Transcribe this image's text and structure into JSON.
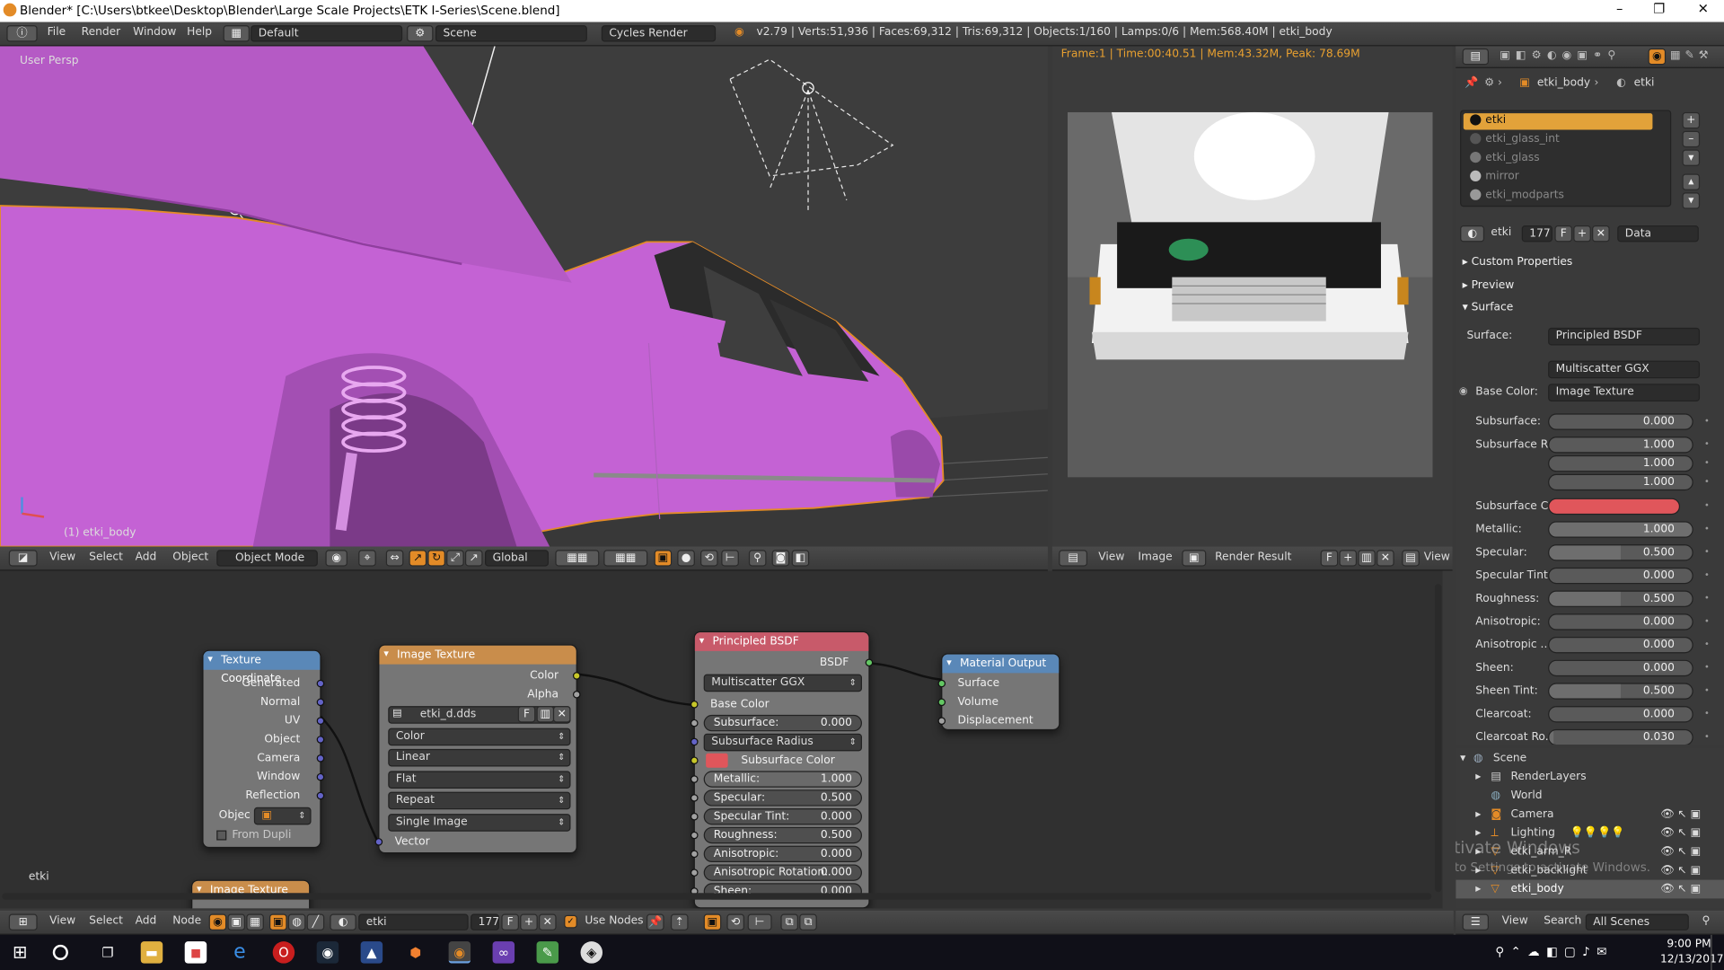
{
  "window": {
    "title": "Blender* [C:\\Users\\btkee\\Desktop\\Blender\\Large Scale Projects\\ETK I-Series\\Scene.blend]",
    "min": "–",
    "max": "❐",
    "close": "✕"
  },
  "info_header": {
    "menus": [
      "File",
      "Render",
      "Window",
      "Help"
    ],
    "screen_layout": "Default",
    "scene": "Scene",
    "engine": "Cycles Render",
    "stats": "v2.79 | Verts:51,936 | Faces:69,312 | Tris:69,312 | Objects:1/160 | Lamps:0/6 | Mem:568.40M | etki_body"
  },
  "viewport": {
    "view_name": "User Persp",
    "object_label": "(1) etki_body",
    "header": {
      "menus": [
        "View",
        "Select",
        "Add",
        "Object"
      ],
      "mode": "Object Mode",
      "orientation": "Global"
    }
  },
  "render_view": {
    "status": "Frame:1 | Time:00:40.51 | Mem:43.32M, Peak: 78.69M",
    "header": {
      "menus": [
        "View",
        "Image"
      ],
      "image_name": "Render Result",
      "f": "F",
      "view_label": "View"
    }
  },
  "nodes": {
    "texture_coordinate": {
      "title": "Texture Coordinate",
      "outputs": [
        "Generated",
        "Normal",
        "UV",
        "Object",
        "Camera",
        "Window",
        "Reflection"
      ],
      "object_label": "Objec",
      "from_dupli": "From Dupli"
    },
    "image_texture": {
      "title": "Image Texture",
      "outputs": [
        "Color",
        "Alpha"
      ],
      "image": "etki_d.dds",
      "f": "F",
      "color_space": "Color",
      "interpolation": "Linear",
      "projection": "Flat",
      "extension": "Repeat",
      "source": "Single Image",
      "input": "Vector"
    },
    "principled": {
      "title": "Principled BSDF",
      "output": "BSDF",
      "distribution": "Multiscatter GGX",
      "base_color": "Base Color",
      "subsurface_label": "Subsurface:",
      "subsurface": "0.000",
      "subsurface_radius": "Subsurface Radius",
      "subsurface_color": "Subsurface Color",
      "metallic_label": "Metallic:",
      "metallic": "1.000",
      "specular_label": "Specular:",
      "specular": "0.500",
      "spec_tint_label": "Specular Tint:",
      "spec_tint": "0.000",
      "roughness_label": "Roughness:",
      "roughness": "0.500",
      "aniso_label": "Anisotropic:",
      "aniso": "0.000",
      "aniso_rot_label": "Anisotropic Rotation:",
      "aniso_rot": "0.000",
      "sheen_label": "Sheen:",
      "sheen": "0.000"
    },
    "material_output": {
      "title": "Material Output",
      "inputs": [
        "Surface",
        "Volume",
        "Displacement"
      ]
    },
    "image_texture2": {
      "title": "Image Texture"
    },
    "material_name": "etki",
    "header": {
      "menus": [
        "View",
        "Select",
        "Add",
        "Node"
      ],
      "material": "etki",
      "users": "177",
      "f": "F",
      "use_nodes": "Use Nodes"
    }
  },
  "properties": {
    "breadcrumb": [
      "etki_body",
      "etki"
    ],
    "slots": [
      "etki",
      "etki_glass_int",
      "etki_glass",
      "mirror",
      "etki_modparts"
    ],
    "material_name": "etki",
    "users": "177",
    "f": "F",
    "link": "Data",
    "sections": [
      "Custom Properties",
      "Preview",
      "Surface"
    ],
    "surface_label": "Surface:",
    "surface": "Principled BSDF",
    "distribution": "Multiscatter GGX",
    "base_color_label": "Base Color:",
    "base_color": "Image Texture",
    "rows": [
      {
        "label": "Subsurface:",
        "value": "0.000",
        "fill": 0
      },
      {
        "label": "Subsurface R...",
        "value": "1.000",
        "fill": 0
      },
      {
        "label": "",
        "value": "1.000",
        "fill": 0
      },
      {
        "label": "",
        "value": "1.000",
        "fill": 0
      },
      {
        "label": "Subsurface C...",
        "value": "",
        "fill": 0
      },
      {
        "label": "Metallic:",
        "value": "1.000",
        "fill": 1
      },
      {
        "label": "Specular:",
        "value": "0.500",
        "fill": 0.5
      },
      {
        "label": "Specular Tint:",
        "value": "0.000",
        "fill": 0
      },
      {
        "label": "Roughness:",
        "value": "0.500",
        "fill": 0.5
      },
      {
        "label": "Anisotropic:",
        "value": "0.000",
        "fill": 0
      },
      {
        "label": "Anisotropic ...",
        "value": "0.000",
        "fill": 0
      },
      {
        "label": "Sheen:",
        "value": "0.000",
        "fill": 0
      },
      {
        "label": "Sheen Tint:",
        "value": "0.500",
        "fill": 0.5
      },
      {
        "label": "Clearcoat:",
        "value": "0.000",
        "fill": 0
      },
      {
        "label": "Clearcoat Ro...",
        "value": "0.030",
        "fill": 0.03
      }
    ]
  },
  "outliner": {
    "items": [
      "Scene",
      "RenderLayers",
      "World",
      "Camera",
      "Lighting",
      "etki_arm_R",
      "etki_backlight",
      "etki_body"
    ],
    "header": {
      "menus": [
        "View",
        "Search"
      ],
      "filter": "All Scenes"
    }
  },
  "watermark": {
    "line1": "Activate Windows",
    "line2": "Go to Settings to activate Windows."
  },
  "taskbar": {
    "time": "9:00 PM",
    "date": "12/13/2017"
  },
  "colors": {
    "accent": "#e38b27",
    "selection": "#d38be0",
    "subsurface_color": "#e0565b",
    "principled_header": "#c85a6a",
    "texcoord_header": "#5a88b8",
    "imagetex_header": "#c98d4b",
    "output_header": "#5a88b8"
  }
}
